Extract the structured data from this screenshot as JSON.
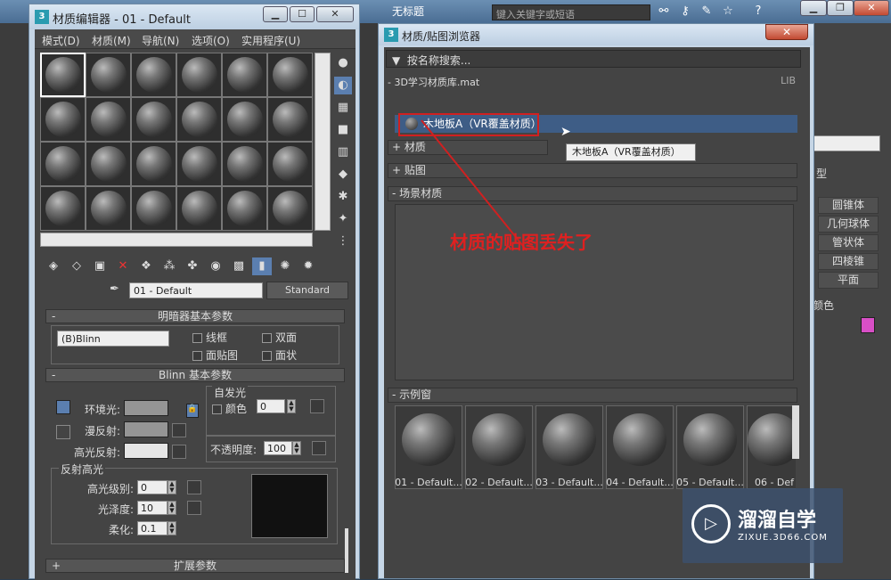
{
  "app": {
    "title": "无标题",
    "search_placeholder": "键入关键字或短语"
  },
  "mat_editor": {
    "title": "材质编辑器 - 01 - Default",
    "menu": [
      "模式(D)",
      "材质(M)",
      "导航(N)",
      "选项(O)",
      "实用程序(U)"
    ],
    "material_name": "01 - Default",
    "type_button": "Standard",
    "shader_rollout": {
      "title": "明暗器基本参数",
      "shader": "(B)Blinn",
      "options": [
        "线框",
        "双面",
        "面贴图",
        "面状"
      ]
    },
    "blinn_rollout": {
      "title": "Blinn 基本参数",
      "ambient_label": "环境光:",
      "diffuse_label": "漫反射:",
      "specular_label": "高光反射:",
      "self_illum_title": "自发光",
      "color_label": "颜色",
      "color_value": "0",
      "opacity_label": "不透明度:",
      "opacity_value": "100"
    },
    "spec_highlights": {
      "title": "反射高光",
      "level_label": "高光级别:",
      "level_value": "0",
      "gloss_label": "光泽度:",
      "gloss_value": "10",
      "soften_label": "柔化:",
      "soften_value": "0.1"
    },
    "extended_rollout": "扩展参数"
  },
  "mat_browser": {
    "title": "材质/贴图浏览器",
    "search_placeholder": "按名称搜索...",
    "library": "- 3D学习材质库.mat",
    "library_tag": "LIB",
    "selected_item": "木地板A（VR覆盖材质）",
    "tooltip": "木地板A（VR覆盖材质）",
    "categories": [
      "+ 材质",
      "+ 贴图",
      "- 场景材质",
      "- 示例窗"
    ],
    "annotation": "材质的贴图丢失了",
    "samples": [
      "01 - Default...",
      "02 - Default...",
      "03 - Default...",
      "04 - Default...",
      "05 - Default...",
      "06 - Def"
    ]
  },
  "right_panel": {
    "items": [
      "圆锥体",
      "几何球体",
      "管状体",
      "四棱锥",
      "平面"
    ],
    "partial_labels": [
      "型",
      "颜色"
    ]
  },
  "watermark": {
    "brand": "溜溜自学",
    "url": "ZIXUE.3D66.COM"
  }
}
